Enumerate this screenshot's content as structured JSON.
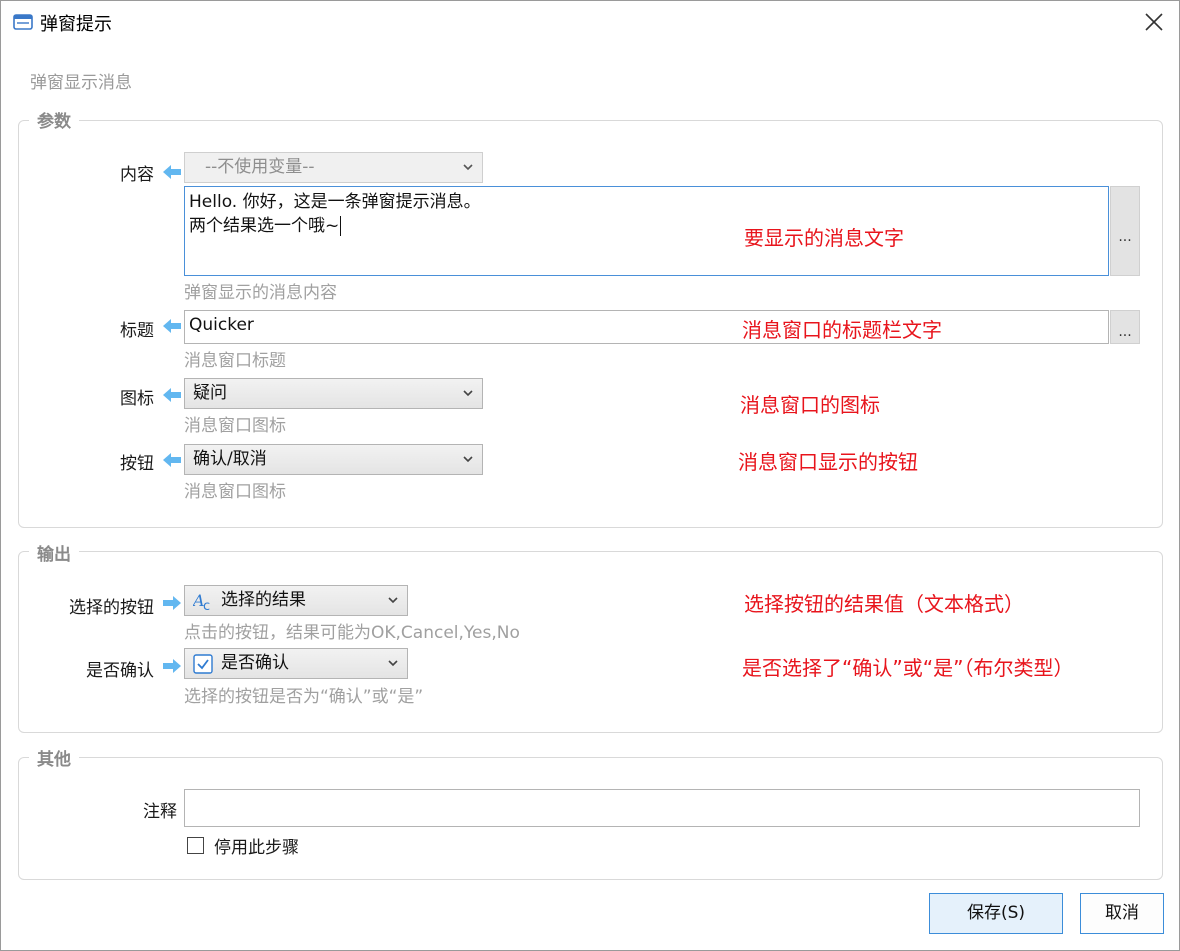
{
  "window": {
    "title": "弹窗提示",
    "subtitle": "弹窗显示消息"
  },
  "groups": {
    "params": "参数",
    "output": "输出",
    "other": "其他"
  },
  "params": {
    "content": {
      "label": "内容",
      "variable_select": "--不使用变量--",
      "value_line1": "Hello. 你好，这是一条弹窗提示消息。",
      "value_line2": "两个结果选一个哦~",
      "hint": "弹窗显示的消息内容",
      "annotation": "要显示的消息文字",
      "more_button": "..."
    },
    "title": {
      "label": "标题",
      "value": "Quicker",
      "hint": "消息窗口标题",
      "annotation": "消息窗口的标题栏文字",
      "more_button": "..."
    },
    "icon": {
      "label": "图标",
      "selected": "疑问",
      "hint": "消息窗口图标",
      "annotation": "消息窗口的图标"
    },
    "buttons": {
      "label": "按钮",
      "selected": "确认/取消",
      "hint": "消息窗口图标",
      "annotation": "消息窗口显示的按钮"
    }
  },
  "output": {
    "selected_button": {
      "label": "选择的按钮",
      "variable": "选择的结果",
      "hint": "点击的按钮，结果可能为OK,Cancel,Yes,No",
      "annotation": "选择按钮的结果值（文本格式）"
    },
    "is_confirm": {
      "label": "是否确认",
      "variable": "是否确认",
      "hint": "选择的按钮是否为“确认”或“是”",
      "annotation": "是否选择了“确认”或“是”（布尔类型）"
    }
  },
  "other": {
    "note_label": "注释",
    "note_value": "",
    "disable_step_label": "停用此步骤",
    "disable_step_checked": false
  },
  "footer": {
    "save": "保存(S)",
    "cancel": "取消"
  },
  "colors": {
    "annotation": "#e8141c",
    "accent": "#3c8dd9",
    "arrow": "#62b7f0"
  }
}
